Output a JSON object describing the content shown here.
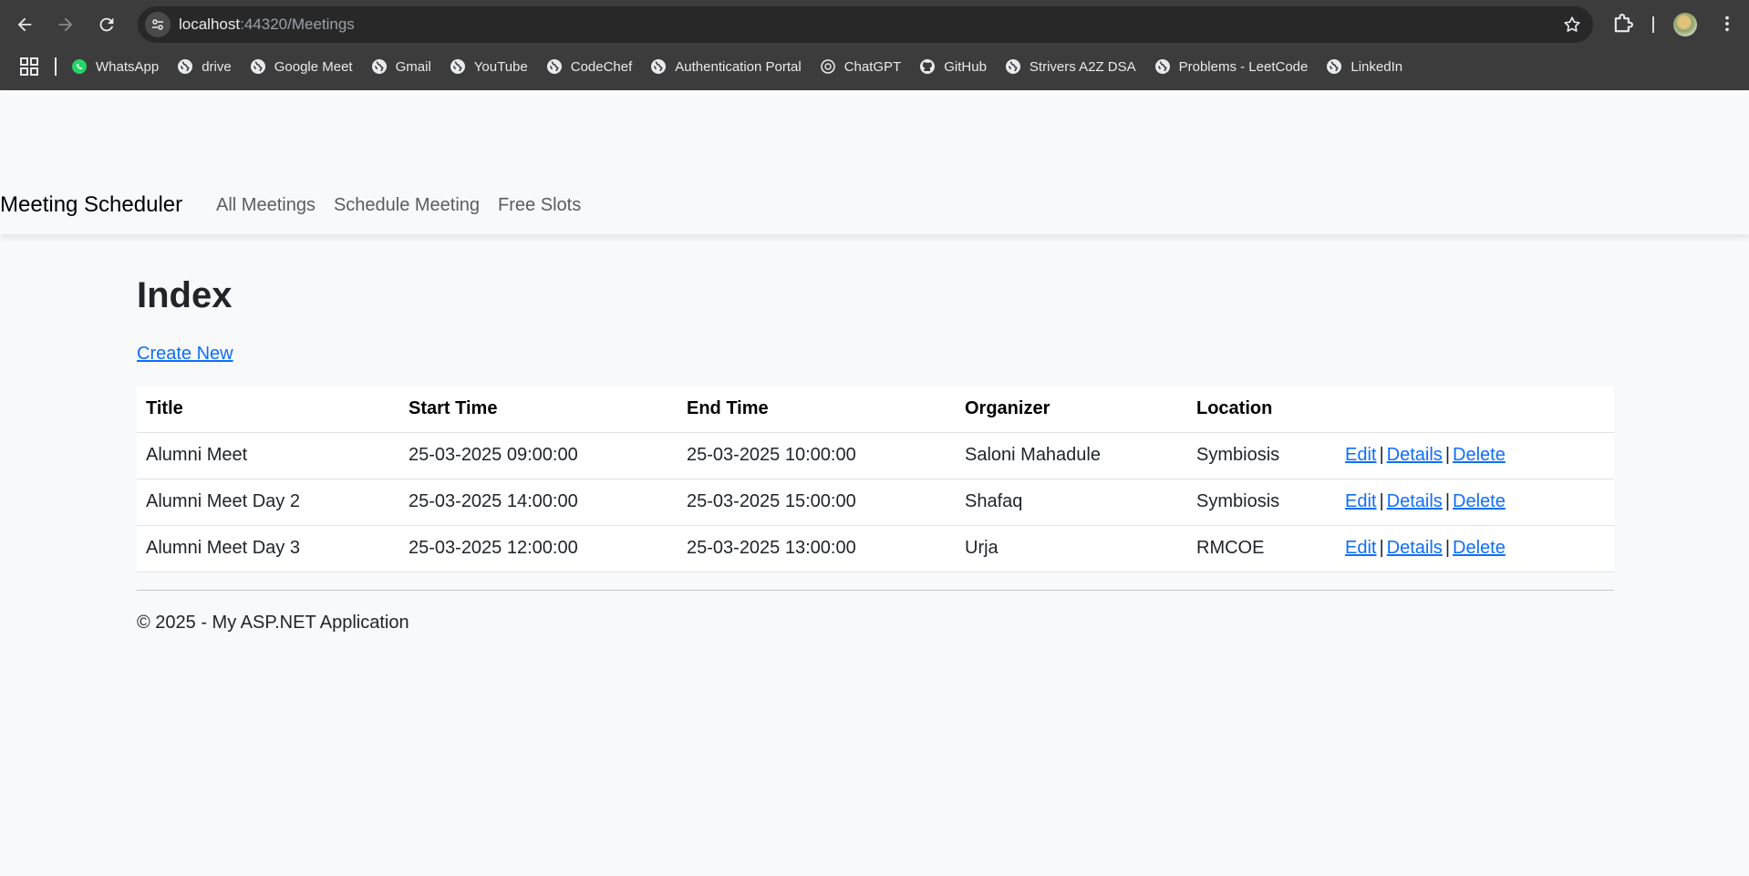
{
  "browser": {
    "url_host": "localhost",
    "url_path": ":44320/Meetings",
    "bookmarks": [
      {
        "label": "WhatsApp",
        "icon": "whatsapp-icon"
      },
      {
        "label": "drive",
        "icon": "globe-icon"
      },
      {
        "label": "Google Meet",
        "icon": "globe-icon"
      },
      {
        "label": "Gmail",
        "icon": "globe-icon"
      },
      {
        "label": "YouTube",
        "icon": "globe-icon"
      },
      {
        "label": "CodeChef",
        "icon": "globe-icon"
      },
      {
        "label": "Authentication Portal",
        "icon": "globe-icon"
      },
      {
        "label": "ChatGPT",
        "icon": "chatgpt-icon"
      },
      {
        "label": "GitHub",
        "icon": "github-icon"
      },
      {
        "label": "Strivers A2Z DSA",
        "icon": "globe-icon"
      },
      {
        "label": "Problems - LeetCode",
        "icon": "globe-icon"
      },
      {
        "label": "LinkedIn",
        "icon": "globe-icon"
      }
    ]
  },
  "nav": {
    "brand": "Meeting Scheduler",
    "links": [
      "All Meetings",
      "Schedule Meeting",
      "Free Slots"
    ]
  },
  "main": {
    "title": "Index",
    "create_link": "Create New",
    "table": {
      "headers": [
        "Title",
        "Start Time",
        "End Time",
        "Organizer",
        "Location"
      ],
      "rows": [
        [
          "Alumni Meet",
          "25-03-2025 09:00:00",
          "25-03-2025 10:00:00",
          "Saloni Mahadule",
          "Symbiosis"
        ],
        [
          "Alumni Meet Day 2",
          "25-03-2025 14:00:00",
          "25-03-2025 15:00:00",
          "Shafaq",
          "Symbiosis"
        ],
        [
          "Alumni Meet Day 3",
          "25-03-2025 12:00:00",
          "25-03-2025 13:00:00",
          "Urja",
          "RMCOE"
        ]
      ],
      "actions": {
        "edit": "Edit",
        "details": "Details",
        "delete": "Delete",
        "separator": "|"
      }
    }
  },
  "footer": {
    "text": "© 2025 - My ASP.NET Application"
  },
  "colors": {
    "chrome_bg": "#3c3c3c",
    "link": "#0d6efd",
    "page_bg": "#f8f9fa"
  }
}
